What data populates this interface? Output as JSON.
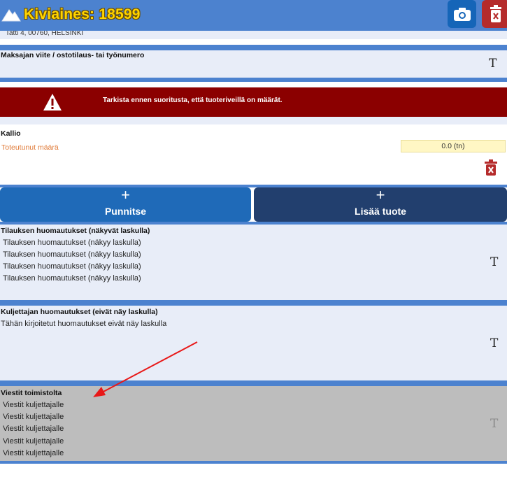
{
  "header": {
    "title": "Kiviaines: 18599",
    "camera_icon": "camera-icon",
    "delete_icon": "trash-icon"
  },
  "address": "Tatti 4, 00760, HELSINKI",
  "reference": {
    "label": "Maksajan viite / ostotilaus- tai työnumero",
    "text_icon": "T"
  },
  "warning": {
    "text": "Tarkista ennen suoritusta, että tuoteriveillä on määrät."
  },
  "product": {
    "name": "Kallio",
    "qty_label": "Toteutunut määrä",
    "qty_value": "0.0 (tn)"
  },
  "actions": {
    "weigh_plus": "+",
    "weigh_label": "Punnitse",
    "add_plus": "+",
    "add_label": "Lisää tuote"
  },
  "order_notes": {
    "label": "Tilauksen huomautukset (näkyvät laskulla)",
    "lines": [
      "Tilauksen huomautukset (näkyy laskulla)",
      "Tilauksen huomautukset (näkyy laskulla)",
      "Tilauksen huomautukset (näkyy laskulla)",
      "Tilauksen huomautukset (näkyy laskulla)"
    ],
    "text_icon": "T"
  },
  "driver_notes": {
    "label": "Kuljettajan huomautukset (eivät näy laskulla)",
    "placeholder": "Tähän kirjoitetut huomautukset eivät näy laskulla",
    "text_icon": "T"
  },
  "office_messages": {
    "label": "Viestit toimistolta",
    "lines": [
      "Viestit kuljettajalle",
      "Viestit kuljettajalle",
      "Viestit kuljettajalle",
      "Viestit kuljettajalle",
      "Viestit kuljettajalle"
    ],
    "text_icon": "T"
  },
  "colors": {
    "header": "#4c82cf",
    "brand_yellow": "#ffd400",
    "warning": "#8b0000",
    "weigh_button": "#1f6ab8",
    "add_button": "#223f6e",
    "qty_label": "#e07b39",
    "annotation_arrow": "#e81818"
  }
}
